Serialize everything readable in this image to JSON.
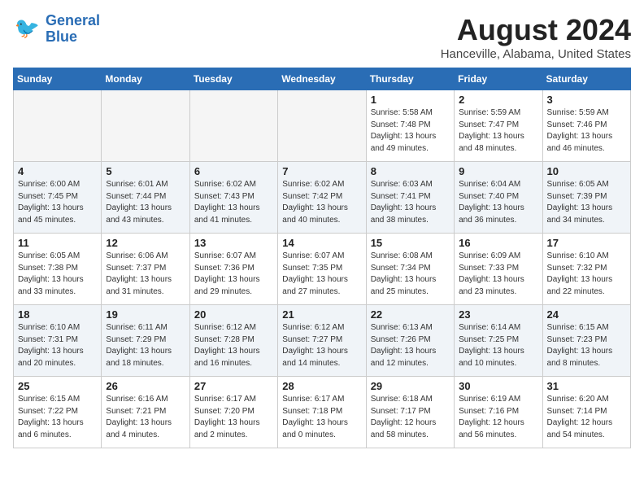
{
  "header": {
    "logo_line1": "General",
    "logo_line2": "Blue",
    "month_year": "August 2024",
    "location": "Hanceville, Alabama, United States"
  },
  "weekdays": [
    "Sunday",
    "Monday",
    "Tuesday",
    "Wednesday",
    "Thursday",
    "Friday",
    "Saturday"
  ],
  "weeks": [
    [
      {
        "day": "",
        "info": ""
      },
      {
        "day": "",
        "info": ""
      },
      {
        "day": "",
        "info": ""
      },
      {
        "day": "",
        "info": ""
      },
      {
        "day": "1",
        "info": "Sunrise: 5:58 AM\nSunset: 7:48 PM\nDaylight: 13 hours\nand 49 minutes."
      },
      {
        "day": "2",
        "info": "Sunrise: 5:59 AM\nSunset: 7:47 PM\nDaylight: 13 hours\nand 48 minutes."
      },
      {
        "day": "3",
        "info": "Sunrise: 5:59 AM\nSunset: 7:46 PM\nDaylight: 13 hours\nand 46 minutes."
      }
    ],
    [
      {
        "day": "4",
        "info": "Sunrise: 6:00 AM\nSunset: 7:45 PM\nDaylight: 13 hours\nand 45 minutes."
      },
      {
        "day": "5",
        "info": "Sunrise: 6:01 AM\nSunset: 7:44 PM\nDaylight: 13 hours\nand 43 minutes."
      },
      {
        "day": "6",
        "info": "Sunrise: 6:02 AM\nSunset: 7:43 PM\nDaylight: 13 hours\nand 41 minutes."
      },
      {
        "day": "7",
        "info": "Sunrise: 6:02 AM\nSunset: 7:42 PM\nDaylight: 13 hours\nand 40 minutes."
      },
      {
        "day": "8",
        "info": "Sunrise: 6:03 AM\nSunset: 7:41 PM\nDaylight: 13 hours\nand 38 minutes."
      },
      {
        "day": "9",
        "info": "Sunrise: 6:04 AM\nSunset: 7:40 PM\nDaylight: 13 hours\nand 36 minutes."
      },
      {
        "day": "10",
        "info": "Sunrise: 6:05 AM\nSunset: 7:39 PM\nDaylight: 13 hours\nand 34 minutes."
      }
    ],
    [
      {
        "day": "11",
        "info": "Sunrise: 6:05 AM\nSunset: 7:38 PM\nDaylight: 13 hours\nand 33 minutes."
      },
      {
        "day": "12",
        "info": "Sunrise: 6:06 AM\nSunset: 7:37 PM\nDaylight: 13 hours\nand 31 minutes."
      },
      {
        "day": "13",
        "info": "Sunrise: 6:07 AM\nSunset: 7:36 PM\nDaylight: 13 hours\nand 29 minutes."
      },
      {
        "day": "14",
        "info": "Sunrise: 6:07 AM\nSunset: 7:35 PM\nDaylight: 13 hours\nand 27 minutes."
      },
      {
        "day": "15",
        "info": "Sunrise: 6:08 AM\nSunset: 7:34 PM\nDaylight: 13 hours\nand 25 minutes."
      },
      {
        "day": "16",
        "info": "Sunrise: 6:09 AM\nSunset: 7:33 PM\nDaylight: 13 hours\nand 23 minutes."
      },
      {
        "day": "17",
        "info": "Sunrise: 6:10 AM\nSunset: 7:32 PM\nDaylight: 13 hours\nand 22 minutes."
      }
    ],
    [
      {
        "day": "18",
        "info": "Sunrise: 6:10 AM\nSunset: 7:31 PM\nDaylight: 13 hours\nand 20 minutes."
      },
      {
        "day": "19",
        "info": "Sunrise: 6:11 AM\nSunset: 7:29 PM\nDaylight: 13 hours\nand 18 minutes."
      },
      {
        "day": "20",
        "info": "Sunrise: 6:12 AM\nSunset: 7:28 PM\nDaylight: 13 hours\nand 16 minutes."
      },
      {
        "day": "21",
        "info": "Sunrise: 6:12 AM\nSunset: 7:27 PM\nDaylight: 13 hours\nand 14 minutes."
      },
      {
        "day": "22",
        "info": "Sunrise: 6:13 AM\nSunset: 7:26 PM\nDaylight: 13 hours\nand 12 minutes."
      },
      {
        "day": "23",
        "info": "Sunrise: 6:14 AM\nSunset: 7:25 PM\nDaylight: 13 hours\nand 10 minutes."
      },
      {
        "day": "24",
        "info": "Sunrise: 6:15 AM\nSunset: 7:23 PM\nDaylight: 13 hours\nand 8 minutes."
      }
    ],
    [
      {
        "day": "25",
        "info": "Sunrise: 6:15 AM\nSunset: 7:22 PM\nDaylight: 13 hours\nand 6 minutes."
      },
      {
        "day": "26",
        "info": "Sunrise: 6:16 AM\nSunset: 7:21 PM\nDaylight: 13 hours\nand 4 minutes."
      },
      {
        "day": "27",
        "info": "Sunrise: 6:17 AM\nSunset: 7:20 PM\nDaylight: 13 hours\nand 2 minutes."
      },
      {
        "day": "28",
        "info": "Sunrise: 6:17 AM\nSunset: 7:18 PM\nDaylight: 13 hours\nand 0 minutes."
      },
      {
        "day": "29",
        "info": "Sunrise: 6:18 AM\nSunset: 7:17 PM\nDaylight: 12 hours\nand 58 minutes."
      },
      {
        "day": "30",
        "info": "Sunrise: 6:19 AM\nSunset: 7:16 PM\nDaylight: 12 hours\nand 56 minutes."
      },
      {
        "day": "31",
        "info": "Sunrise: 6:20 AM\nSunset: 7:14 PM\nDaylight: 12 hours\nand 54 minutes."
      }
    ]
  ]
}
